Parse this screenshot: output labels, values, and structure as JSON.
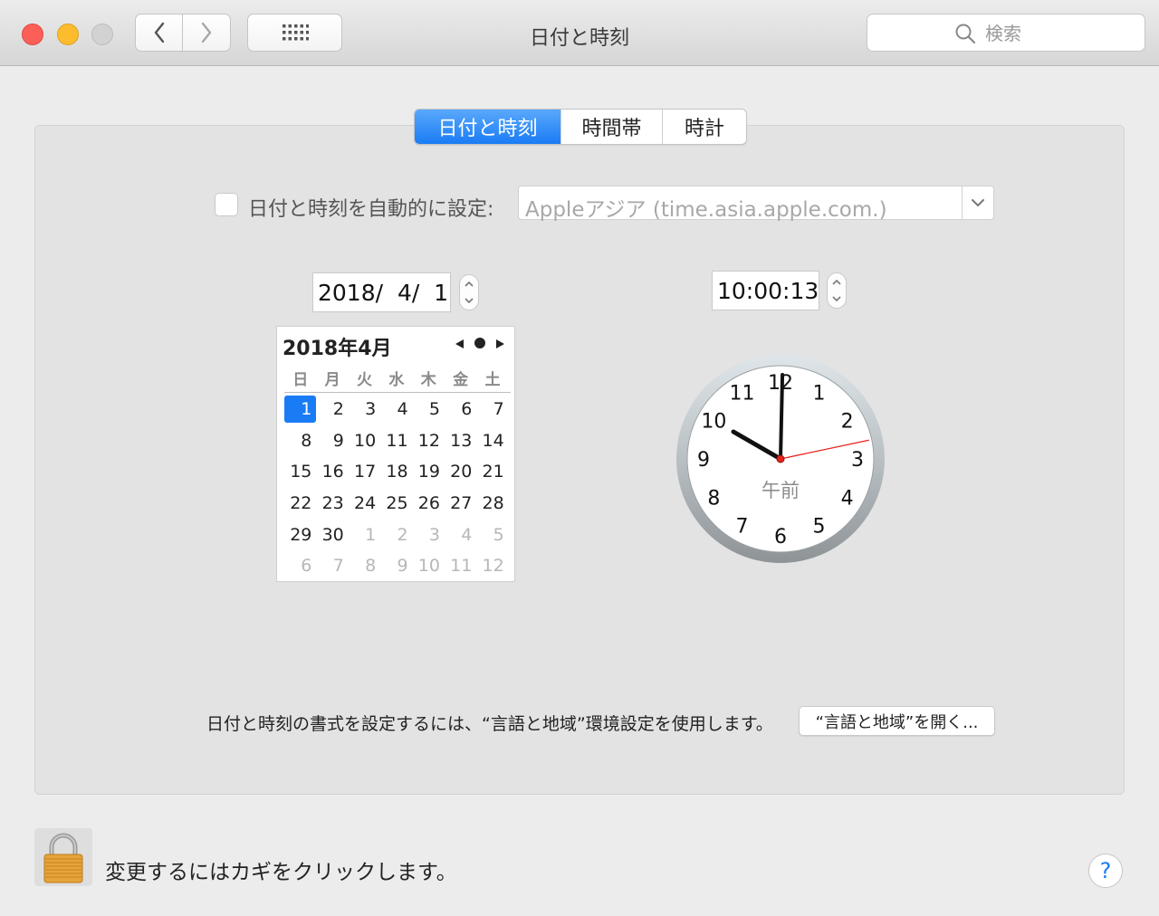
{
  "window": {
    "title": "日付と時刻"
  },
  "toolbar": {
    "search_placeholder": "検索"
  },
  "tabs": [
    {
      "label": "日付と時刻",
      "active": true
    },
    {
      "label": "時間帯",
      "active": false
    },
    {
      "label": "時計",
      "active": false
    }
  ],
  "auto": {
    "checked": false,
    "label": "日付と時刻を自動的に設定:",
    "server": "Appleアジア (time.asia.apple.com.)"
  },
  "date_field": "2018/  4/  1",
  "time_field": "10:00:13",
  "calendar": {
    "title": "2018年4月",
    "weekdays": [
      "日",
      "月",
      "火",
      "水",
      "木",
      "金",
      "土"
    ],
    "weeks": [
      [
        {
          "d": "1",
          "sel": true
        },
        {
          "d": "2"
        },
        {
          "d": "3"
        },
        {
          "d": "4"
        },
        {
          "d": "5"
        },
        {
          "d": "6"
        },
        {
          "d": "7"
        }
      ],
      [
        {
          "d": "8"
        },
        {
          "d": "9"
        },
        {
          "d": "10"
        },
        {
          "d": "11"
        },
        {
          "d": "12"
        },
        {
          "d": "13"
        },
        {
          "d": "14"
        }
      ],
      [
        {
          "d": "15"
        },
        {
          "d": "16"
        },
        {
          "d": "17"
        },
        {
          "d": "18"
        },
        {
          "d": "19"
        },
        {
          "d": "20"
        },
        {
          "d": "21"
        }
      ],
      [
        {
          "d": "22"
        },
        {
          "d": "23"
        },
        {
          "d": "24"
        },
        {
          "d": "25"
        },
        {
          "d": "26"
        },
        {
          "d": "27"
        },
        {
          "d": "28"
        }
      ],
      [
        {
          "d": "29"
        },
        {
          "d": "30"
        },
        {
          "d": "1",
          "muted": true
        },
        {
          "d": "2",
          "muted": true
        },
        {
          "d": "3",
          "muted": true
        },
        {
          "d": "4",
          "muted": true
        },
        {
          "d": "5",
          "muted": true
        }
      ],
      [
        {
          "d": "6",
          "muted": true
        },
        {
          "d": "7",
          "muted": true
        },
        {
          "d": "8",
          "muted": true
        },
        {
          "d": "9",
          "muted": true
        },
        {
          "d": "10",
          "muted": true
        },
        {
          "d": "11",
          "muted": true
        },
        {
          "d": "12",
          "muted": true
        }
      ]
    ]
  },
  "clock": {
    "numbers": [
      "12",
      "1",
      "2",
      "3",
      "4",
      "5",
      "6",
      "7",
      "8",
      "9",
      "10",
      "11"
    ],
    "ampm": "午前",
    "hours": 10,
    "minutes": 0,
    "seconds": 13
  },
  "format": {
    "text": "日付と時刻の書式を設定するには、“言語と地域”環境設定を使用します。",
    "button": "“言語と地域”を開く..."
  },
  "lock": {
    "text": "変更するにはカギをクリックします。"
  },
  "help": {
    "label": "?"
  },
  "colors": {
    "accent": "#1a7cf5",
    "second_hand": "#e8231c",
    "close": "#fc5f57",
    "minimize": "#fdbc2e"
  }
}
